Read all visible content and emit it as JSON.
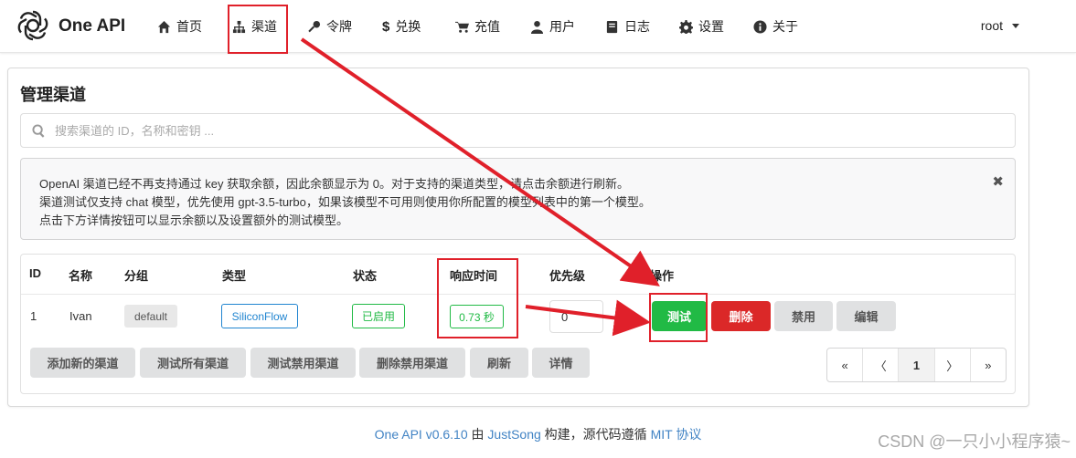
{
  "nav": {
    "brand": "One API",
    "items": [
      {
        "label": "首页",
        "icon": "home-icon"
      },
      {
        "label": "渠道",
        "icon": "sitemap-icon"
      },
      {
        "label": "令牌",
        "icon": "key-icon"
      },
      {
        "label": "兑换",
        "icon": "dollar-icon"
      },
      {
        "label": "充值",
        "icon": "cart-icon"
      },
      {
        "label": "用户",
        "icon": "user-icon"
      },
      {
        "label": "日志",
        "icon": "book-icon"
      },
      {
        "label": "设置",
        "icon": "gear-icon"
      },
      {
        "label": "关于",
        "icon": "info-icon"
      }
    ],
    "user": "root"
  },
  "page": {
    "title": "管理渠道",
    "search_placeholder": "搜索渠道的 ID，名称和密钥 ...",
    "notice": [
      "OpenAI 渠道已经不再支持通过 key 获取余额，因此余额显示为 0。对于支持的渠道类型，请点击余额进行刷新。",
      "渠道测试仅支持 chat 模型，优先使用 gpt-3.5-turbo，如果该模型不可用则使用你所配置的模型列表中的第一个模型。",
      "点击下方详情按钮可以显示余额以及设置额外的测试模型。"
    ],
    "close": "✖"
  },
  "table": {
    "headers": [
      "ID",
      "名称",
      "分组",
      "类型",
      "状态",
      "响应时间",
      "优先级",
      "操作"
    ],
    "rows": [
      {
        "id": "1",
        "name": "Ivan",
        "group": "default",
        "type": "SiliconFlow",
        "status": "已启用",
        "response_time": "0.73 秒",
        "priority": "0",
        "actions": [
          "测试",
          "删除",
          "禁用",
          "编辑"
        ]
      }
    ]
  },
  "bottom_buttons": [
    "添加新的渠道",
    "测试所有渠道",
    "测试禁用渠道",
    "删除禁用渠道",
    "刷新",
    "详情"
  ],
  "pagination": [
    "«",
    "〈",
    "1",
    "〉",
    "»"
  ],
  "footer": {
    "part1": "One API v0.6.10",
    "part2": " 由 ",
    "part3": "JustSong",
    "part4": " 构建，源代码遵循 ",
    "part5": "MIT 协议"
  },
  "watermark": "CSDN @一只小小程序猿~",
  "colors": {
    "accent_green": "#21ba45",
    "danger_red": "#db2828",
    "link_blue": "#4183c4",
    "annotation_red": "#e0202a"
  }
}
